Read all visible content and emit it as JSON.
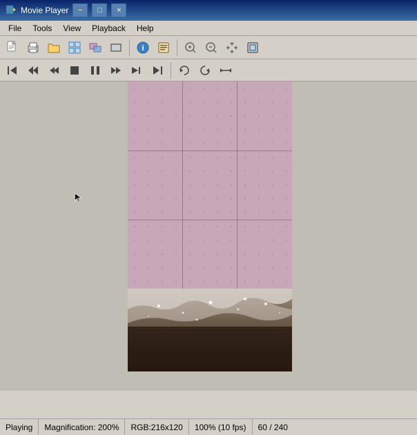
{
  "window": {
    "title": "Movie Player",
    "icon": "▶",
    "minimize_label": "−",
    "maximize_label": "□",
    "close_label": "×"
  },
  "menu": {
    "items": [
      {
        "label": "File"
      },
      {
        "label": "Tools"
      },
      {
        "label": "View"
      },
      {
        "label": "Playback"
      },
      {
        "label": "Help"
      }
    ]
  },
  "toolbar1": {
    "buttons": [
      {
        "name": "new-btn",
        "icon": "🗋"
      },
      {
        "name": "open-btn",
        "icon": "📂"
      },
      {
        "name": "capture-btn",
        "icon": "📷"
      },
      {
        "name": "multi-btn",
        "icon": "⊞"
      },
      {
        "name": "effects-btn",
        "icon": "✦"
      },
      {
        "name": "fullscreen-btn",
        "icon": "⊡"
      },
      {
        "name": "info-btn",
        "icon": "ℹ"
      },
      {
        "name": "props-btn",
        "icon": "📋"
      },
      {
        "name": "zoom-in-btn",
        "icon": "🔍"
      },
      {
        "name": "zoom-out-btn",
        "icon": "🔎"
      },
      {
        "name": "pan-btn",
        "icon": "✋"
      },
      {
        "name": "fit-btn",
        "icon": "⊞"
      }
    ]
  },
  "toolbar2": {
    "buttons": [
      {
        "name": "first-btn",
        "icon": "⏮"
      },
      {
        "name": "prev-btn",
        "icon": "⏪"
      },
      {
        "name": "rewind-btn",
        "icon": "◀◀"
      },
      {
        "name": "stop-btn",
        "icon": "■"
      },
      {
        "name": "pause-btn",
        "icon": "⏸"
      },
      {
        "name": "forward-btn",
        "icon": "▶▶"
      },
      {
        "name": "next-frame-btn",
        "icon": "▶|"
      },
      {
        "name": "last-btn",
        "icon": "⏭"
      },
      {
        "name": "loop-btn",
        "icon": "↺"
      },
      {
        "name": "loop2-btn",
        "icon": "↻"
      },
      {
        "name": "ab-btn",
        "icon": "⇄"
      }
    ]
  },
  "status": {
    "playing": "Playing",
    "magnification": "Magnification: 200%",
    "rgb": "RGB:216x120",
    "fps": "100% (10 fps)",
    "frame": "60 / 240"
  }
}
